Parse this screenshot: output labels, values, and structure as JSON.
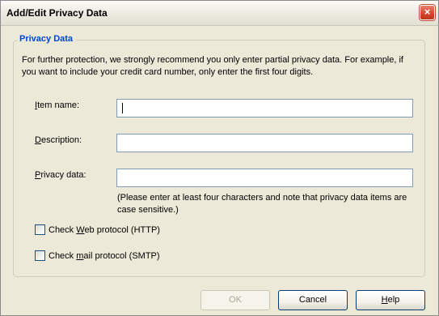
{
  "window": {
    "title": "Add/Edit Privacy Data",
    "close_symbol": "×"
  },
  "group": {
    "label": "Privacy Data",
    "intro": "For further protection, we strongly recommend you only enter partial privacy data. For example, if you want to include your credit card number, only enter the first four digits."
  },
  "fields": {
    "item_name": {
      "mnemonic": "I",
      "rest": "tem name:",
      "value": ""
    },
    "description": {
      "mnemonic": "D",
      "rest": "escription:",
      "value": ""
    },
    "privacy_data": {
      "mnemonic": "P",
      "rest": "rivacy data:",
      "value": ""
    }
  },
  "hint": "(Please enter at least four characters and note that privacy data items are case sensitive.)",
  "checks": {
    "web": {
      "before": "Check ",
      "mnemonic": "W",
      "after": "eb protocol (HTTP)",
      "checked": false
    },
    "mail": {
      "before": "Check ",
      "mnemonic": "m",
      "after": "ail protocol (SMTP)",
      "checked": false
    }
  },
  "buttons": {
    "ok": "OK",
    "cancel": "Cancel",
    "help_mnemonic": "H",
    "help_rest": "elp"
  },
  "colors": {
    "group_label": "#0046d5",
    "dialog_bg": "#ECE9D8",
    "close_red": "#d5442b"
  }
}
